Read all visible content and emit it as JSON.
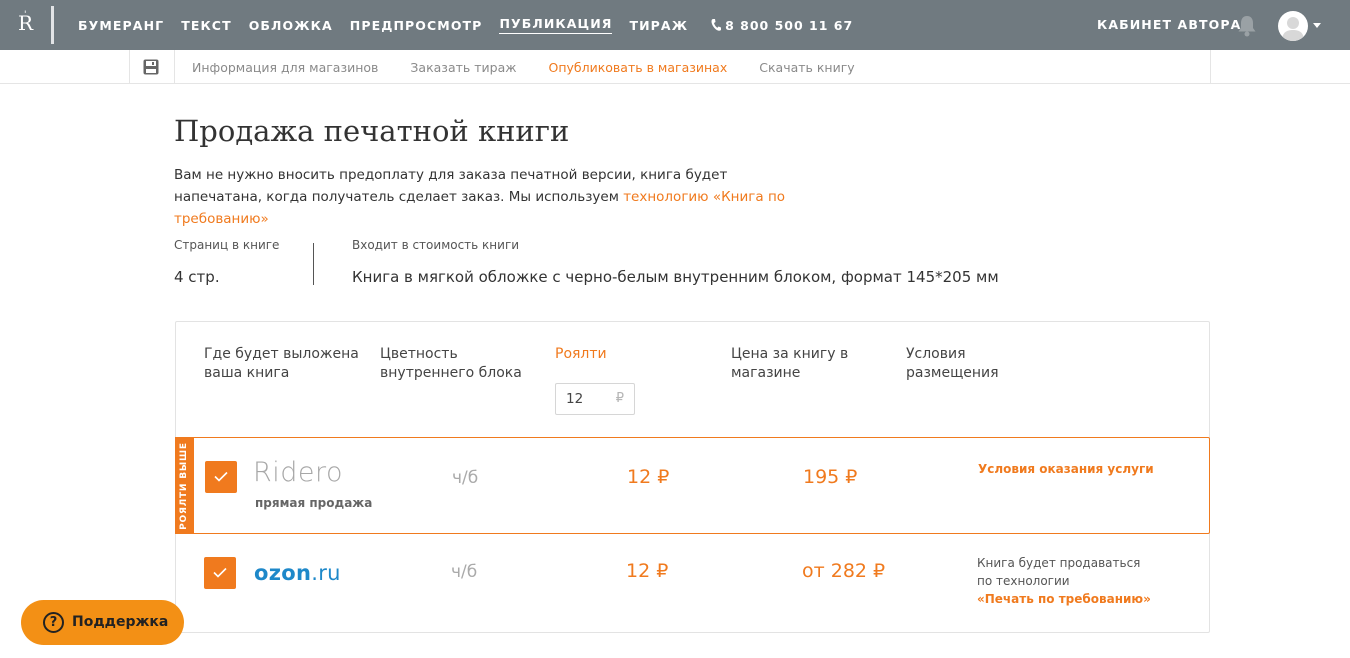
{
  "header": {
    "logo_letter": "R",
    "logo_mark": "'",
    "nav": [
      {
        "label": "БУМЕРАНГ"
      },
      {
        "label": "ТЕКСТ"
      },
      {
        "label": "ОБЛОЖКА"
      },
      {
        "label": "ПРЕДПРОСМОТР"
      },
      {
        "label": "ПУБЛИКАЦИЯ",
        "active": true
      },
      {
        "label": "ТИРАЖ"
      }
    ],
    "phone": "8 800 500 11 67",
    "cabinet_label": "КАБИНЕТ АВТОРА",
    "icons": {
      "phone": "phone-icon",
      "bell": "bell-icon",
      "avatar": "avatar-icon",
      "dropdown": "chevron-down-icon"
    }
  },
  "subnav": {
    "save_icon": "save-icon",
    "items": [
      {
        "label": "Информация для магазинов"
      },
      {
        "label": "Заказать тираж"
      },
      {
        "label": "Опубликовать в магазинах",
        "active": true
      },
      {
        "label": "Скачать книгу"
      }
    ]
  },
  "page": {
    "title": "Продажа печатной книги",
    "intro_text": "Вам не нужно вносить предоплату для заказа печатной версии, книга будет напечатана, когда получатель сделает заказ. Мы используем ",
    "intro_link": "технологию «Книга по требованию»"
  },
  "info": {
    "pages_label": "Страниц в книге",
    "pages_value": "4 стр.",
    "includes_label": "Входит в стоимость книги",
    "includes_value": "Книга в мягкой обложке с черно-белым внутренним блоком, формат 145*205 мм"
  },
  "table": {
    "headers": {
      "store": "Где будет выложена ваша книга",
      "color": "Цветность внутреннего блока",
      "royalty": "Роялти",
      "price": "Цена за книгу в магазине",
      "terms": "Условия размещения"
    },
    "royalty_input": {
      "value": "12",
      "currency": "₽"
    },
    "rows": [
      {
        "ribbon": "РОЯЛТИ ВЫШЕ",
        "store_logo": "Ridero",
        "store_sub": "прямая продажа",
        "color": "ч/б",
        "royalty": "12 ₽",
        "price": "195 ₽",
        "terms_link": "Условия оказания услуги",
        "checked": true
      },
      {
        "store_logo_main": "ozon",
        "store_logo_tld": ".ru",
        "color": "ч/б",
        "royalty": "12 ₽",
        "price": "от 282 ₽",
        "terms_line1": "Книга будет продаваться",
        "terms_line2": "по технологии",
        "terms_link": "«Печать по требованию»",
        "checked": true
      }
    ]
  },
  "support": {
    "label": "Поддержка",
    "icon": "?"
  },
  "colors": {
    "accent": "#f07a1e",
    "topbar": "#707a80",
    "ozon": "#1e88c9",
    "support": "#f39015"
  }
}
